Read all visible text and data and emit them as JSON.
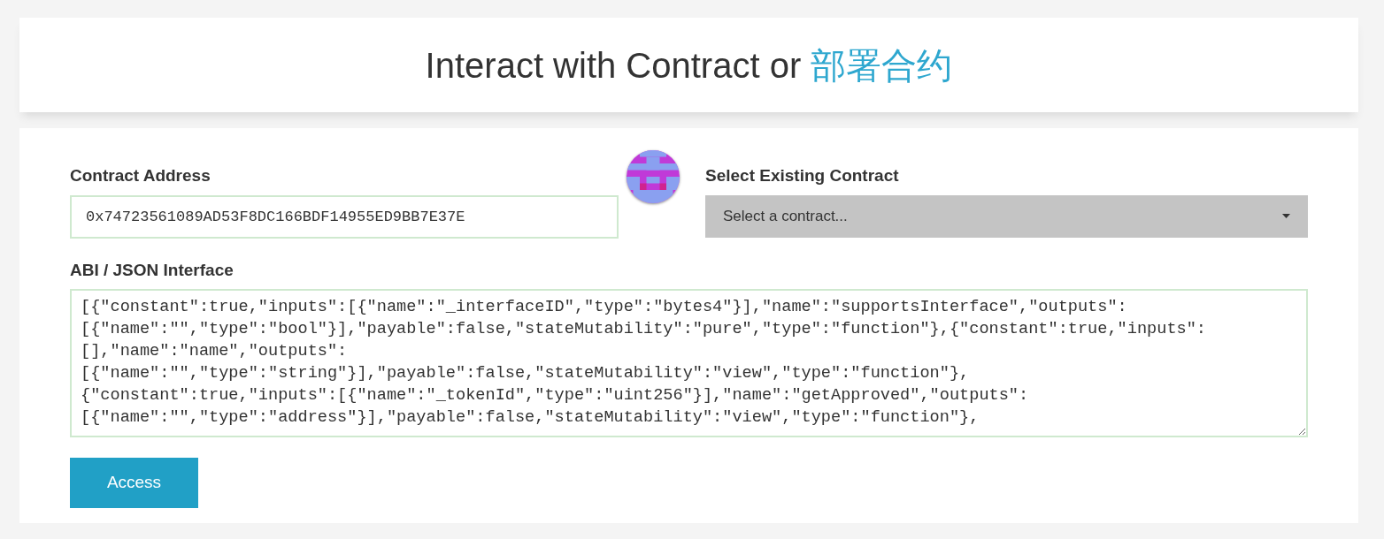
{
  "header": {
    "title": "Interact with Contract",
    "connector": "or",
    "link": "部署合约"
  },
  "address": {
    "label": "Contract Address",
    "value": "0x74723561089AD53F8DC166BDF14955ED9BB7E37E"
  },
  "existing": {
    "label": "Select Existing Contract",
    "value": "Select a contract..."
  },
  "abi": {
    "label": "ABI / JSON Interface",
    "lines": [
      "[{\"constant\":true,\"inputs\":[{\"name\":\"_interfaceID\",\"type\":\"bytes4\"}],\"name\":\"supportsInterface\",\"outputs\":",
      "[{\"name\":\"\",\"type\":\"bool\"}],\"payable\":false,\"stateMutability\":\"pure\",\"type\":\"function\"},{\"constant\":true,\"inputs\":",
      "[],\"name\":\"name\",\"outputs\":",
      "[{\"name\":\"\",\"type\":\"string\"}],\"payable\":false,\"stateMutability\":\"view\",\"type\":\"function\"},",
      "{\"constant\":true,\"inputs\":[{\"name\":\"_tokenId\",\"type\":\"uint256\"}],\"name\":\"getApproved\",\"outputs\":",
      "[{\"name\":\"\",\"type\":\"address\"}],\"payable\":false,\"stateMutability\":\"view\",\"type\":\"function\"},"
    ]
  },
  "button": "Access"
}
